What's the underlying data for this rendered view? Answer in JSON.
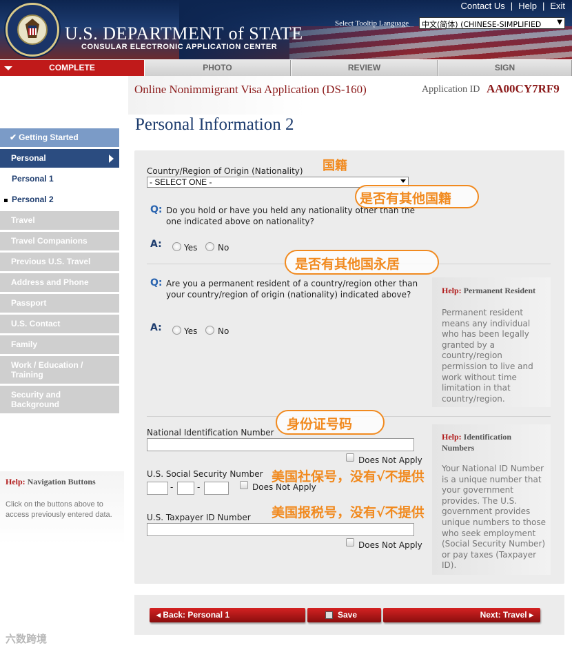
{
  "header": {
    "seal_label": "U.S. Department of State seal",
    "dept_title": "U.S. DEPARTMENT of STATE",
    "dept_subtitle": "CONSULAR ELECTRONIC APPLICATION CENTER",
    "links": [
      "Contact Us",
      "Help",
      "Exit"
    ],
    "tooltip_label": "Select Tooltip Language",
    "language_value": "中文(简体)  (CHINESE-SIMPLIFIED"
  },
  "steps": [
    "COMPLETE",
    "PHOTO",
    "REVIEW",
    "SIGN"
  ],
  "app": {
    "title": "Online Nonimmigrant Visa Application (DS-160)",
    "id_label": "Application ID",
    "id_value": "AA00CY7RF9"
  },
  "page_title": "Personal Information 2",
  "nav": {
    "items": [
      {
        "label": "Getting Started",
        "state": "done"
      },
      {
        "label": "Personal",
        "state": "current"
      },
      {
        "label": "Personal 1",
        "state": "sub"
      },
      {
        "label": "Personal 2",
        "state": "sub-selected"
      },
      {
        "label": "Travel",
        "state": "disabled"
      },
      {
        "label": "Travel Companions",
        "state": "disabled"
      },
      {
        "label": "Previous U.S. Travel",
        "state": "disabled"
      },
      {
        "label": "Address and Phone",
        "state": "disabled"
      },
      {
        "label": "Passport",
        "state": "disabled"
      },
      {
        "label": "U.S. Contact",
        "state": "disabled"
      },
      {
        "label": "Family",
        "state": "disabled"
      },
      {
        "label": "Work / Education / Training",
        "state": "disabled"
      },
      {
        "label": "Security and Background",
        "state": "disabled"
      }
    ],
    "help_title_prefix": "Help:",
    "help_title": "Navigation Buttons",
    "help_text": "Click on the buttons above to access previously entered data."
  },
  "form": {
    "nationality_label": "Country/Region of Origin (Nationality)",
    "nationality_value": "- SELECT ONE -",
    "q_marker": "Q:",
    "a_marker": "A:",
    "q1": "Do you hold or have you held any nationality other than the one indicated above on nationality?",
    "q2": "Are you a permanent resident of a country/region other than your country/region of origin (nationality) indicated above?",
    "yes": "Yes",
    "no": "No",
    "national_id_label": "National Identification Number",
    "ssn_label": "U.S. Social Security Number",
    "taxpayer_label": "U.S. Taxpayer ID Number",
    "does_not_apply": "Does Not Apply",
    "dash": "-"
  },
  "help": {
    "prefix": "Help:",
    "resident_title": "Permanent Resident",
    "resident_text": "Permanent resident means any individual who has been legally granted by a country/region permission to live and work without time limitation in that country/region.",
    "id_title": "Identification Numbers",
    "id_text": "Your National ID Number is a unique number that your government provides. The U.S. government provides unique numbers to those who seek employment (Social Security Number) or pay taxes (Taxpayer ID)."
  },
  "annotations": {
    "nationality": "国籍",
    "other_nationality": "是否有其他国籍",
    "other_residence": "是否有其他国永居",
    "id_number": "身份证号码",
    "ssn_note": "美国社保号，没有√不提供",
    "tax_note": "美国报税号，没有√不提供",
    "color": "#f18a1f"
  },
  "buttons": {
    "back": "Back: Personal 1",
    "save": "Save",
    "next": "Next: Travel"
  },
  "watermark": "六数跨境"
}
